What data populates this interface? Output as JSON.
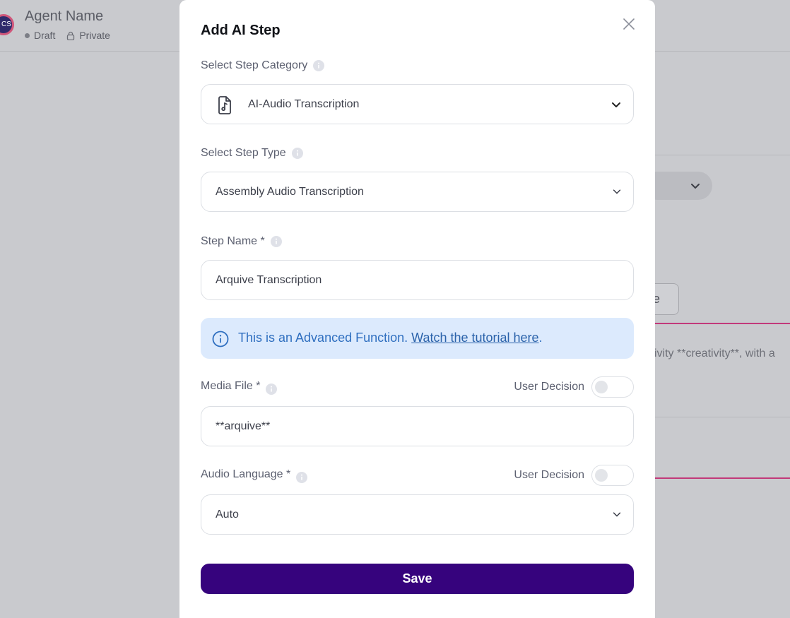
{
  "background": {
    "avatar_initials": "CS",
    "agent_name": "Agent Name",
    "status": "Draft",
    "visibility": "Private",
    "button_fragment": "ce",
    "text_fragment": "ivity **creativity**, with a"
  },
  "modal": {
    "title": "Add AI Step",
    "step_category": {
      "label": "Select Step Category",
      "value": "AI-Audio Transcription",
      "icon": "audio-file-icon"
    },
    "step_type": {
      "label": "Select Step Type",
      "value": "Assembly Audio Transcription"
    },
    "step_name": {
      "label": "Step Name *",
      "value": "Arquive Transcription"
    },
    "info_banner": {
      "text": "This is an Advanced Function. ",
      "link_text": "Watch the tutorial here",
      "suffix": "."
    },
    "media_file": {
      "label": "Media File *",
      "toggle_label": "User Decision",
      "value": "**arquive**"
    },
    "audio_language": {
      "label": "Audio Language *",
      "toggle_label": "User Decision",
      "value": "Auto"
    },
    "save_label": "Save"
  },
  "colors": {
    "primary": "#36037d",
    "info_bg": "#dceafd",
    "info_text": "#2f6fc0",
    "accent_line": "#c2397a"
  }
}
